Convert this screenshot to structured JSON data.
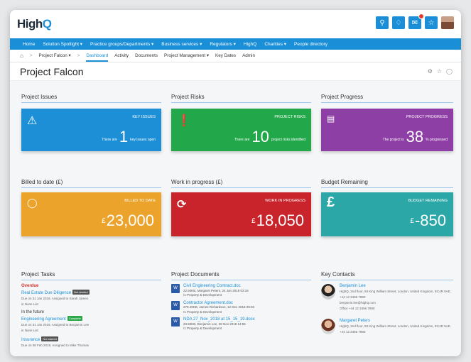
{
  "app": {
    "logo_text": "High",
    "logo_q": "Q"
  },
  "topbar": {
    "icons": [
      "search-icon",
      "bell-icon",
      "mail-icon",
      "star-icon"
    ],
    "accent": "#1a8fd8"
  },
  "mainnav": [
    "Home",
    "Solution Spotlight ▾",
    "Practice groups/Departments ▾",
    "Business services ▾",
    "Regulators ▾",
    "HighQ",
    "Charities ▾",
    "People directory"
  ],
  "subnav": {
    "project": "Project Falcon ▾",
    "tabs": [
      "Dashboard",
      "Activity",
      "Documents",
      "Project Management ▾",
      "Key Dates",
      "Admin"
    ]
  },
  "page": {
    "title": "Project Falcon"
  },
  "tiles": {
    "issues": {
      "heading": "Project Issues",
      "label": "KEY ISSUES",
      "prefix": "There are",
      "value": "1",
      "suffix": "key issues open",
      "color": "#1d8fd6"
    },
    "risks": {
      "heading": "Project Risks",
      "label": "PROJECT RISKS",
      "prefix": "There are",
      "value": "10",
      "suffix": "project risks identified",
      "color": "#22a84a"
    },
    "progress": {
      "heading": "Project Progress",
      "label": "PROJECT PROGRESS",
      "prefix": "The project is",
      "value": "38",
      "suffix": "% progressed",
      "color": "#8e3fa6"
    },
    "billed": {
      "heading": "Billed to date (£)",
      "label": "BILLED TO DATE",
      "currency": "£",
      "value": "23,000",
      "color": "#eba32c"
    },
    "wip": {
      "heading": "Work in progress (£)",
      "label": "WORK IN PROGRESS",
      "currency": "£",
      "value": "18,050",
      "color": "#c9242b"
    },
    "budget": {
      "heading": "Budget Remaining",
      "label": "BUDGET REMAINING",
      "currency": "£",
      "value": "-850",
      "color": "#2aa7a6"
    }
  },
  "tasks": {
    "heading": "Project Tasks",
    "overdue_label": "Overdue",
    "future_label": "In the future",
    "overdue": [
      {
        "name": "Real Estate Due Diligence",
        "badge": "Not started",
        "meta": "Due on 31 Jan 2019, Assigned to Sarah James",
        "list": "in None List"
      }
    ],
    "future": [
      {
        "name": "Engineering Agreement",
        "badge": "Complete",
        "meta": "Due on 31 Jan 2019, Assigned to Benjamin Lee",
        "list": "in None List"
      },
      {
        "name": "Insurance",
        "badge": "Not started",
        "meta": "Due on 08 Feb 2019, Assigned to Mike Thomas",
        "list": ""
      }
    ]
  },
  "documents": {
    "heading": "Project Documents",
    "items": [
      {
        "name": "Civil Engineering Contract.doc",
        "meta": "22.50KB, Margaret Peters, 24 Jan 2019 03:16",
        "folder": "/1 Property & Development"
      },
      {
        "name": "Contractor Agreement.doc",
        "meta": "279.49KB, James Richardson, 12 Dec 2018 09:03",
        "folder": "/1 Property & Development"
      },
      {
        "name": "NDA 27_Nov_2018 at 15_15_19.docx",
        "meta": "23.50KB, Benjamin Lee, 28 Nov 2018 14:55",
        "folder": "/1 Property & Development"
      }
    ]
  },
  "contacts": {
    "heading": "Key Contacts",
    "items": [
      {
        "name": "Benjamin Lee",
        "address": "HighQ, 2nd floor, 93 King William Street, London, United Kingdom, EC4R 9AE, +44 12 3456 7890",
        "email": "benjamin.lee@highq.com",
        "office": "Office +44 12 3456 7890"
      },
      {
        "name": "Margaret Peters",
        "address": "HighQ, 2nd floor, 93 King William Street, London, United Kingdom, EC4R 9AE, +44 12 3456 7890"
      }
    ]
  }
}
